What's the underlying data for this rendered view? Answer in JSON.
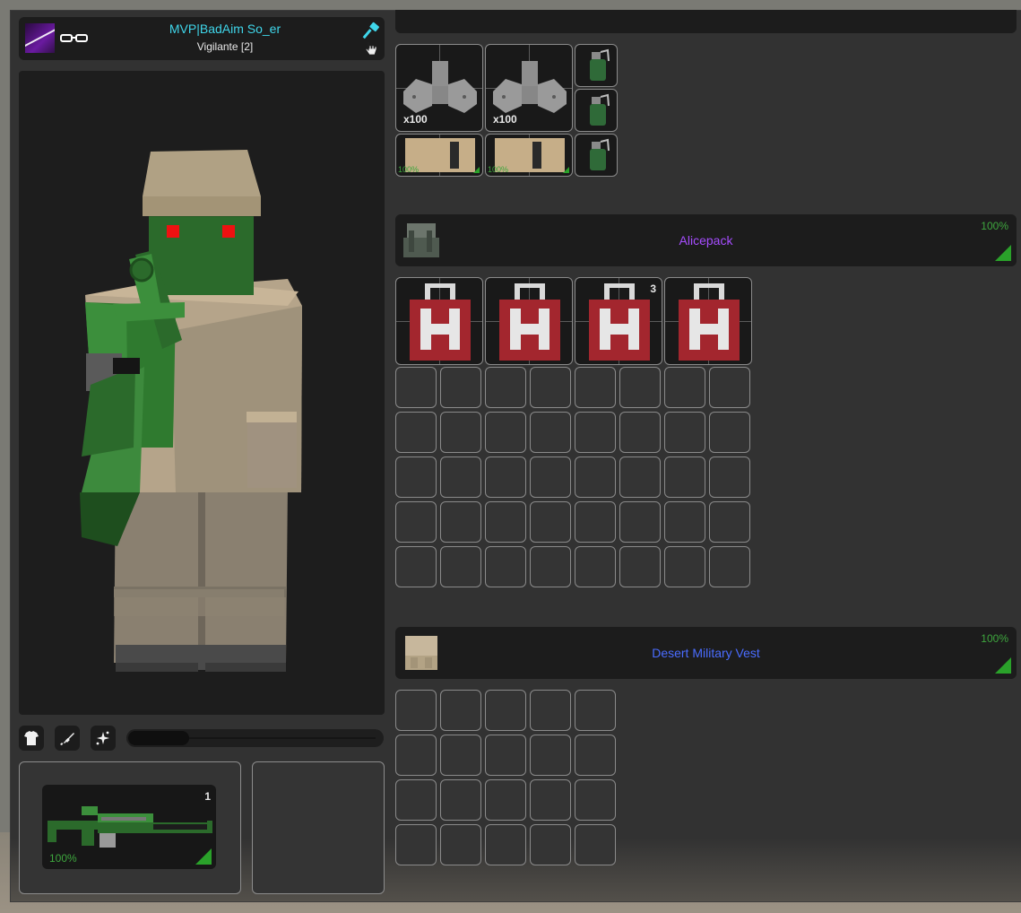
{
  "player": {
    "name": "MVP|BadAim So_er",
    "rank": "Vigilante [2]"
  },
  "weapon_slot": {
    "count": "1",
    "quality": "100%"
  },
  "zoom": {
    "level": 0.2
  },
  "hands_grid": {
    "rows": 3,
    "cols": 5,
    "items": [
      {
        "name": "metal-scrap",
        "qty": "x100"
      },
      {
        "name": "metal-scrap",
        "qty": "x100"
      },
      {
        "name": "cardboard-box",
        "quality": "100%"
      },
      {
        "name": "cardboard-box",
        "quality": "100%"
      },
      {
        "name": "grenade"
      },
      {
        "name": "grenade"
      },
      {
        "name": "grenade"
      }
    ]
  },
  "backpack": {
    "title": "Alicepack",
    "quality": "100%",
    "title_color": "#a64dff",
    "rows": 7,
    "cols": 8,
    "items": [
      {
        "name": "medkit"
      },
      {
        "name": "medkit"
      },
      {
        "name": "medkit",
        "count": "3"
      },
      {
        "name": "medkit"
      }
    ]
  },
  "vest": {
    "title": "Desert Military Vest",
    "quality": "100%",
    "title_color": "#4a6cff",
    "rows": 4,
    "cols": 5
  },
  "colors": {
    "accent_cyan": "#3fd6ea",
    "quality_green": "#2aa12a",
    "medkit_red": "#a3262e"
  }
}
